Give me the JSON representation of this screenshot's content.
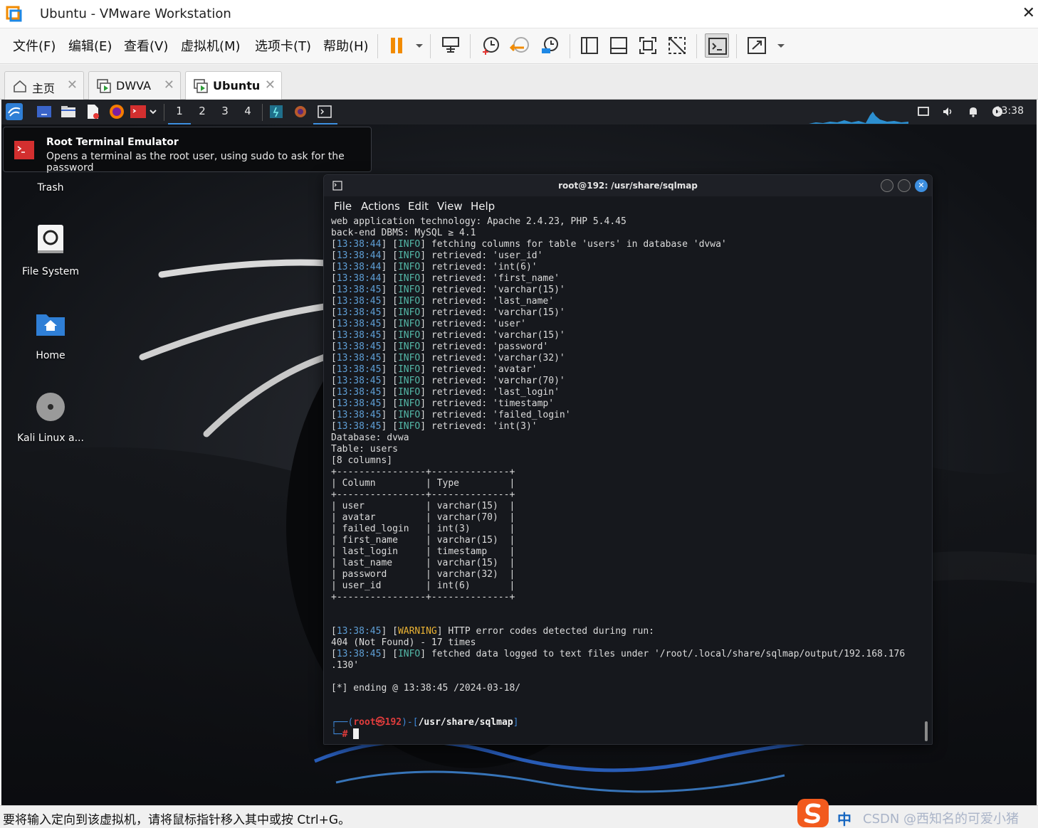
{
  "window": {
    "title": "Ubuntu - VMware Workstation"
  },
  "menu": {
    "items": [
      "文件(F)",
      "编辑(E)",
      "查看(V)",
      "虚拟机(M)",
      "选项卡(T)",
      "帮助(H)"
    ]
  },
  "toolbar": {
    "icons": [
      "pause-icon",
      "dropdown-icon",
      "send-ctrl-alt-del-icon",
      "snapshot-icon",
      "revert-snapshot-icon",
      "snapshot-manager-icon",
      "sidebar-icon",
      "thumbnail-icon",
      "fullscreen-icon",
      "unity-icon",
      "console-view-icon",
      "stretch-icon"
    ]
  },
  "tabs": [
    {
      "label": "主页",
      "icon": "home-icon"
    },
    {
      "label": "DWVA",
      "icon": "vm-icon"
    },
    {
      "label": "Ubuntu",
      "icon": "vm-icon",
      "active": true
    }
  ],
  "panel": {
    "workspaces": [
      "1",
      "2",
      "3",
      "4"
    ],
    "active_workspace": "1",
    "clock": "13:38"
  },
  "tooltip": {
    "title": "Root Terminal Emulator",
    "description": "Opens a terminal as the root user, using sudo to ask for the password"
  },
  "desktop_icons": [
    {
      "label": "Trash"
    },
    {
      "label": "File System"
    },
    {
      "label": "Home"
    },
    {
      "label": "Kali Linux a..."
    }
  ],
  "terminal": {
    "title": "root@192: /usr/share/sqlmap",
    "menu": [
      "File",
      "Actions",
      "Edit",
      "View",
      "Help"
    ],
    "header_lines": [
      "web application technology: Apache 2.4.23, PHP 5.4.45",
      "back-end DBMS: MySQL ≥ 4.1"
    ],
    "log_lines": [
      {
        "time": "13:38:44",
        "level": "INFO",
        "msg": "fetching columns for table 'users' in database 'dvwa'"
      },
      {
        "time": "13:38:44",
        "level": "INFO",
        "msg": "retrieved: 'user_id'"
      },
      {
        "time": "13:38:44",
        "level": "INFO",
        "msg": "retrieved: 'int(6)'"
      },
      {
        "time": "13:38:44",
        "level": "INFO",
        "msg": "retrieved: 'first_name'"
      },
      {
        "time": "13:38:45",
        "level": "INFO",
        "msg": "retrieved: 'varchar(15)'"
      },
      {
        "time": "13:38:45",
        "level": "INFO",
        "msg": "retrieved: 'last_name'"
      },
      {
        "time": "13:38:45",
        "level": "INFO",
        "msg": "retrieved: 'varchar(15)'"
      },
      {
        "time": "13:38:45",
        "level": "INFO",
        "msg": "retrieved: 'user'"
      },
      {
        "time": "13:38:45",
        "level": "INFO",
        "msg": "retrieved: 'varchar(15)'"
      },
      {
        "time": "13:38:45",
        "level": "INFO",
        "msg": "retrieved: 'password'"
      },
      {
        "time": "13:38:45",
        "level": "INFO",
        "msg": "retrieved: 'varchar(32)'"
      },
      {
        "time": "13:38:45",
        "level": "INFO",
        "msg": "retrieved: 'avatar'"
      },
      {
        "time": "13:38:45",
        "level": "INFO",
        "msg": "retrieved: 'varchar(70)'"
      },
      {
        "time": "13:38:45",
        "level": "INFO",
        "msg": "retrieved: 'last_login'"
      },
      {
        "time": "13:38:45",
        "level": "INFO",
        "msg": "retrieved: 'timestamp'"
      },
      {
        "time": "13:38:45",
        "level": "INFO",
        "msg": "retrieved: 'failed_login'"
      },
      {
        "time": "13:38:45",
        "level": "INFO",
        "msg": "retrieved: 'int(3)'"
      }
    ],
    "summary_lines": [
      "Database: dvwa",
      "Table: users",
      "[8 columns]"
    ],
    "table": {
      "headers": [
        "Column",
        "Type"
      ],
      "rows": [
        [
          "user",
          "varchar(15)"
        ],
        [
          "avatar",
          "varchar(70)"
        ],
        [
          "failed_login",
          "int(3)"
        ],
        [
          "first_name",
          "varchar(15)"
        ],
        [
          "last_login",
          "timestamp"
        ],
        [
          "last_name",
          "varchar(15)"
        ],
        [
          "password",
          "varchar(32)"
        ],
        [
          "user_id",
          "int(6)"
        ]
      ]
    },
    "warning": {
      "time": "13:38:45",
      "level": "WARNING",
      "msg": "HTTP error codes detected during run:"
    },
    "warning_detail": "404 (Not Found) - 17 times",
    "final_info": {
      "time": "13:38:45",
      "level": "INFO",
      "msg": "fetched data logged to text files under '/root/.local/share/sqlmap/output/192.168.176"
    },
    "final_info_cont": ".130'",
    "ending": "[*] ending @ 13:38:45 /2024-03-18/",
    "prompt": {
      "user": "root",
      "host": "192",
      "path": "/usr/share/sqlmap",
      "symbol": "#"
    }
  },
  "statusbar": {
    "message": "要将输入定向到该虚拟机，请将鼠标指针移入其中或按 Ctrl+G。",
    "ime": "中",
    "watermark": "CSDN @西知名的可爱小猪"
  }
}
